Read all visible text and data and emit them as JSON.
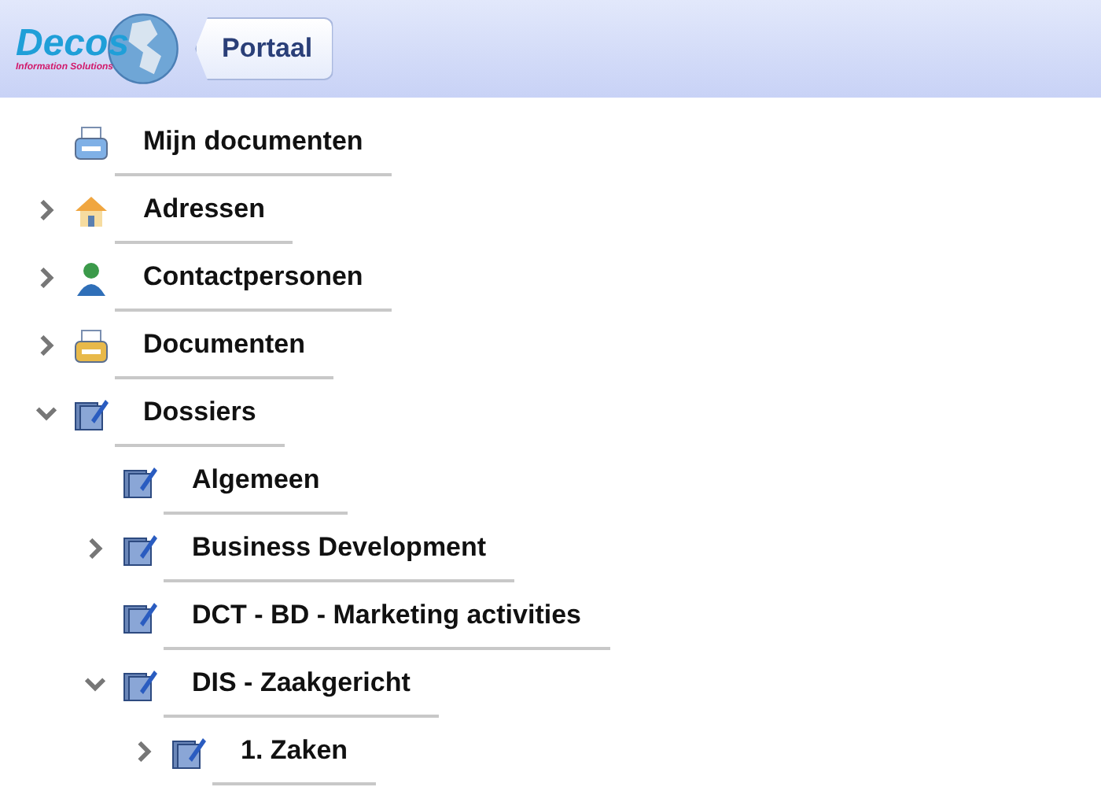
{
  "header": {
    "logo": {
      "name": "Decos",
      "tagline": "Information Solutions"
    },
    "back_button": "Portaal"
  },
  "tree": [
    {
      "label": "Mijn documenten",
      "kind": "printer-blue"
    },
    {
      "label": "Adressen",
      "kind": "house",
      "expanded": false
    },
    {
      "label": "Contactpersonen",
      "kind": "person",
      "expanded": false
    },
    {
      "label": "Documenten",
      "kind": "printer-yellow",
      "expanded": false
    },
    {
      "label": "Dossiers",
      "kind": "folder",
      "expanded": true,
      "children": [
        {
          "label": "Algemeen",
          "kind": "folder"
        },
        {
          "label": "Business Development",
          "kind": "folder",
          "expanded": false
        },
        {
          "label": "DCT - BD - Marketing activities",
          "kind": "folder"
        },
        {
          "label": "DIS - Zaakgericht",
          "kind": "folder",
          "expanded": true,
          "children": [
            {
              "label": "1. Zaken",
              "kind": "folder",
              "expanded": false
            }
          ]
        }
      ]
    }
  ]
}
